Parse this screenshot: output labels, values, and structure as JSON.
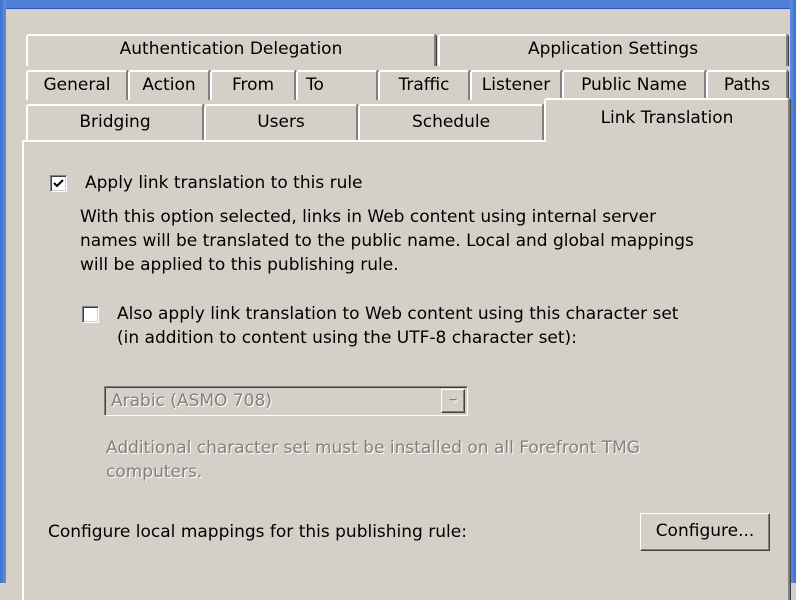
{
  "tabs": {
    "row1": [
      {
        "label": "Authentication Delegation"
      },
      {
        "label": "Application Settings"
      }
    ],
    "row2": [
      {
        "label": "General"
      },
      {
        "label": "Action"
      },
      {
        "label": "From"
      },
      {
        "label": "To"
      },
      {
        "label": "Traffic"
      },
      {
        "label": "Listener"
      },
      {
        "label": "Public Name"
      },
      {
        "label": "Paths"
      }
    ],
    "row3": [
      {
        "label": "Bridging"
      },
      {
        "label": "Users"
      },
      {
        "label": "Schedule"
      },
      {
        "label": "Link Translation"
      }
    ],
    "active": "Link Translation"
  },
  "link_translation": {
    "apply_checkbox_label": "Apply link translation to this rule",
    "apply_checked": true,
    "description_lines": [
      "With this option selected, links in Web content using internal server",
      "names will be translated to the public name. Local and global mappings",
      "will be applied to this publishing rule."
    ],
    "charset_checkbox_lines": [
      "Also apply link translation to Web content using this character set",
      "(in addition to content using the UTF-8 character set):"
    ],
    "charset_checked": false,
    "charset_select_value": "Arabic (ASMO 708)",
    "charset_note_lines": [
      "Additional character set must be installed on all Forefront TMG",
      "computers."
    ],
    "configure_label": "Configure local mappings for this publishing rule:",
    "configure_button": "Configure..."
  },
  "icons": {
    "checkmark": "checkmark-icon",
    "dropdown": "chevron-down-icon"
  }
}
